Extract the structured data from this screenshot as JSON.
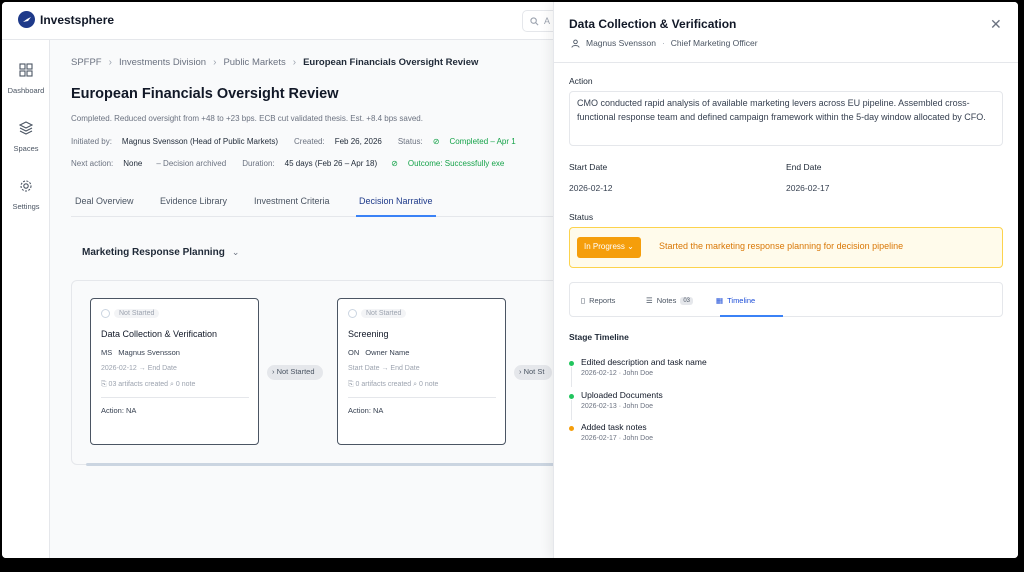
{
  "app": {
    "name": "Investsphere",
    "search_placeholder": "A"
  },
  "sidebar": {
    "items": [
      {
        "label": "Dashboard",
        "icon": "grid-icon"
      },
      {
        "label": "Spaces",
        "icon": "layers-icon"
      },
      {
        "label": "Settings",
        "icon": "gear-icon"
      }
    ]
  },
  "breadcrumb": {
    "items": [
      "SPFPF",
      "Investments Division",
      "Public Markets",
      "European Financials Oversight Review"
    ]
  },
  "page": {
    "title": "European Financials Oversight Review",
    "summary": "Completed. Reduced oversight from +48 to +23 bps. ECB cut validated thesis. Est. +8.4 bps saved.",
    "initiated_label": "Initiated by:",
    "initiated_value": "Magnus Svensson (Head of Public Markets)",
    "created_label": "Created:",
    "created_value": "Feb 26, 2026",
    "status_label": "Status:",
    "status_value": "Completed – Apr 1",
    "next_action_label": "Next action:",
    "next_action_value": "None",
    "decision": "–  Decision archived",
    "duration_label": "Duration:",
    "duration_value": "45 days (Feb 26 – Apr 18)",
    "outcome": "Outcome: Successfully exe"
  },
  "tabs": [
    "Deal Overview",
    "Evidence Library",
    "Investment Criteria",
    "Decision Narrative"
  ],
  "flow": {
    "dropdown": "Marketing Response Planning",
    "cards": [
      {
        "status": "Not Started",
        "title": "Data Collection & Verification",
        "initials": "MS",
        "owner": "Magnus Svensson",
        "dates": "2026-02-12  →  End Date",
        "artifacts": "⎘ 03 artifacts created   ⌕ 0 note",
        "action": "Action: NA"
      },
      {
        "status": "Not Started",
        "title": "Screening",
        "initials": "ON",
        "owner": "Owner Name",
        "dates": "Start Date  →  End Date",
        "artifacts": "⎘ 0 artifacts created   ⌕ 0 note",
        "action": "Action: NA"
      }
    ],
    "connectors": [
      "Not Started",
      "Not St"
    ]
  },
  "drawer": {
    "title": "Data Collection & Verification",
    "owner": "Magnus Svensson",
    "role": "Chief Marketing Officer",
    "action_label": "Action",
    "action_text": "CMO conducted rapid analysis of available marketing levers across EU pipeline. Assembled cross-functional response team and defined campaign framework within the 5-day window allocated by CFO.",
    "start_label": "Start Date",
    "start_value": "2026-02-12",
    "end_label": "End Date",
    "end_value": "2026-02-17",
    "status_label": "Status",
    "status_value": "In Progress",
    "status_note": "Started the marketing response planning for decision pipeline",
    "tabs": {
      "reports": "Reports",
      "notes": "Notes",
      "notes_count": "03",
      "timeline": "Timeline"
    },
    "timeline_label": "Stage Timeline",
    "timeline": [
      {
        "title": "Edited description and task name",
        "meta": "2026-02-12 · John Doe",
        "color": "#22c55e"
      },
      {
        "title": "Uploaded Documents",
        "meta": "2026-02-13 · John Doe",
        "color": "#22c55e"
      },
      {
        "title": "Added task notes",
        "meta": "2026-02-17 · John Doe",
        "color": "#f59e0b"
      }
    ]
  }
}
